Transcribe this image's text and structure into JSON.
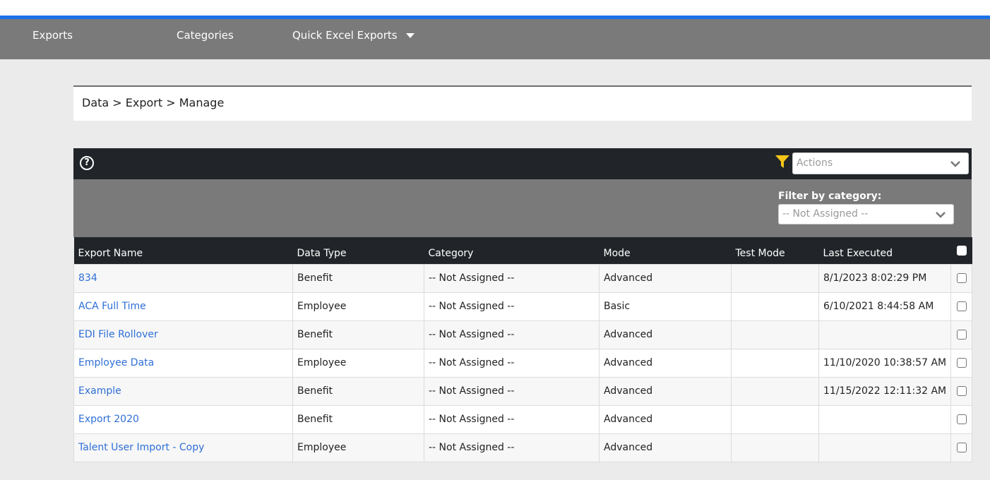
{
  "nav": {
    "exports": "Exports",
    "categories": "Categories",
    "quick_excel": "Quick Excel Exports"
  },
  "breadcrumb": "Data > Export > Manage",
  "toolbar": {
    "help_icon": "help-circle-icon",
    "filter_icon": "funnel-icon",
    "filter_icon_color": "#f5c518",
    "actions_placeholder": "Actions"
  },
  "filter": {
    "label": "Filter by category:",
    "selected": "-- Not Assigned --"
  },
  "table": {
    "columns": [
      "Export Name",
      "Data Type",
      "Category",
      "Mode",
      "Test Mode",
      "Last Executed"
    ],
    "rows": [
      {
        "name": "834",
        "data_type": "Benefit",
        "category": "-- Not Assigned --",
        "mode": "Advanced",
        "test_mode": "",
        "last_executed": "8/1/2023 8:02:29 PM"
      },
      {
        "name": "ACA Full Time",
        "data_type": "Employee",
        "category": "-- Not Assigned --",
        "mode": "Basic",
        "test_mode": "",
        "last_executed": "6/10/2021 8:44:58 AM"
      },
      {
        "name": "EDI File Rollover",
        "data_type": "Benefit",
        "category": "-- Not Assigned --",
        "mode": "Advanced",
        "test_mode": "",
        "last_executed": ""
      },
      {
        "name": "Employee Data",
        "data_type": "Employee",
        "category": "-- Not Assigned --",
        "mode": "Advanced",
        "test_mode": "",
        "last_executed": "11/10/2020 10:38:57 AM"
      },
      {
        "name": "Example",
        "data_type": "Benefit",
        "category": "-- Not Assigned --",
        "mode": "Advanced",
        "test_mode": "",
        "last_executed": "11/15/2022 12:11:32 AM"
      },
      {
        "name": "Export 2020",
        "data_type": "Benefit",
        "category": "-- Not Assigned --",
        "mode": "Advanced",
        "test_mode": "",
        "last_executed": ""
      },
      {
        "name": "Talent User Import - Copy",
        "data_type": "Employee",
        "category": "-- Not Assigned --",
        "mode": "Advanced",
        "test_mode": "",
        "last_executed": ""
      }
    ]
  },
  "colors": {
    "accent_blue": "#1a73e8",
    "nav_gray": "#7a7a7a",
    "header_dark": "#212529",
    "link": "#2f6fd6"
  }
}
